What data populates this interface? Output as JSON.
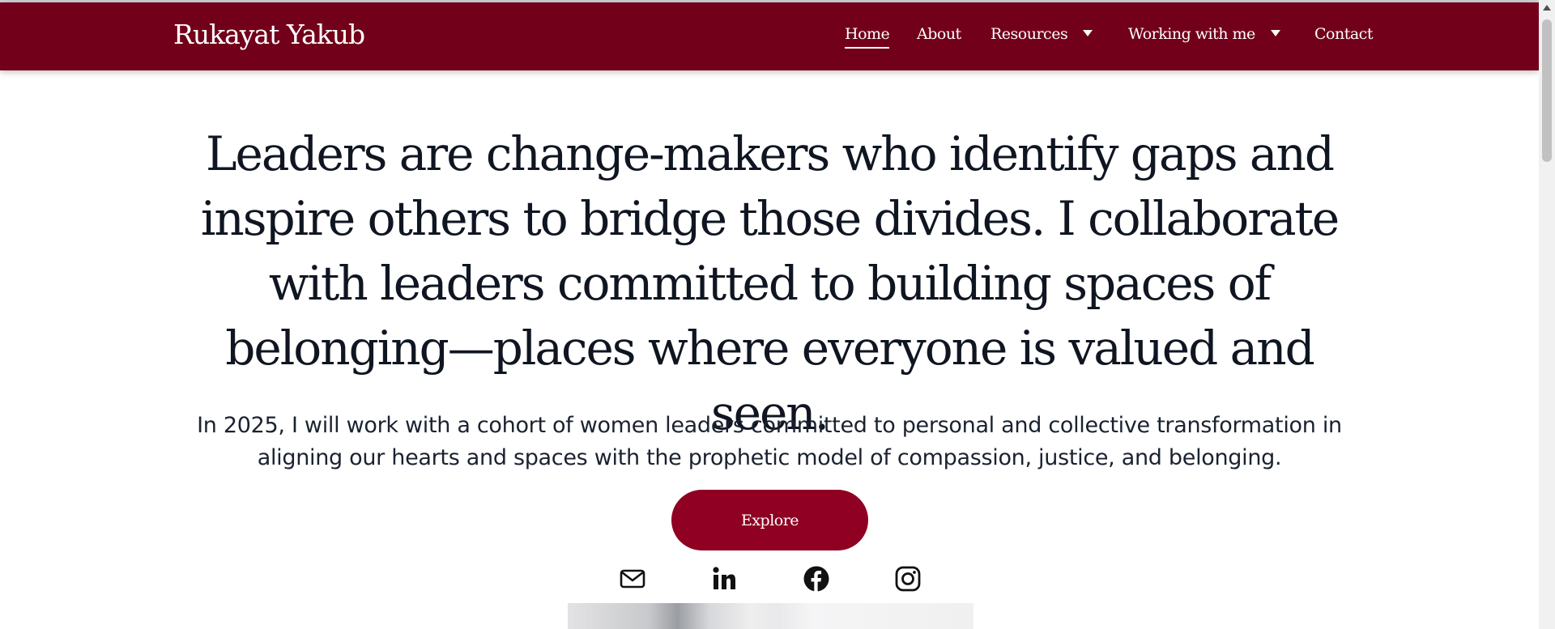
{
  "brand": {
    "name": "Rukayat Yakub"
  },
  "nav": {
    "items": [
      {
        "label": "Home",
        "active": true,
        "has_dropdown": false
      },
      {
        "label": "About",
        "active": false,
        "has_dropdown": false
      },
      {
        "label": "Resources",
        "active": false,
        "has_dropdown": true
      },
      {
        "label": "Working with me",
        "active": false,
        "has_dropdown": true
      },
      {
        "label": "Contact",
        "active": false,
        "has_dropdown": false
      }
    ]
  },
  "hero": {
    "headline": "Leaders are change-makers who identify gaps and inspire others to bridge those divides. I collaborate with leaders committed to building spaces of belonging—places where everyone is valued and seen.",
    "intro": "In 2025, I will work with a cohort of women leaders committed to personal and collective transformation in aligning our hearts and spaces with the prophetic model of compassion, justice, and belonging.",
    "cta_label": "Explore"
  },
  "social": [
    {
      "icon": "mail-icon",
      "name": "email"
    },
    {
      "icon": "linkedin-icon",
      "name": "linkedin"
    },
    {
      "icon": "facebook-icon",
      "name": "facebook"
    },
    {
      "icon": "instagram-icon",
      "name": "instagram"
    }
  ],
  "colors": {
    "nav_bg": "#72001a",
    "button_bg": "#8f0022",
    "text": "#0f1622",
    "background": "#ffffff"
  }
}
